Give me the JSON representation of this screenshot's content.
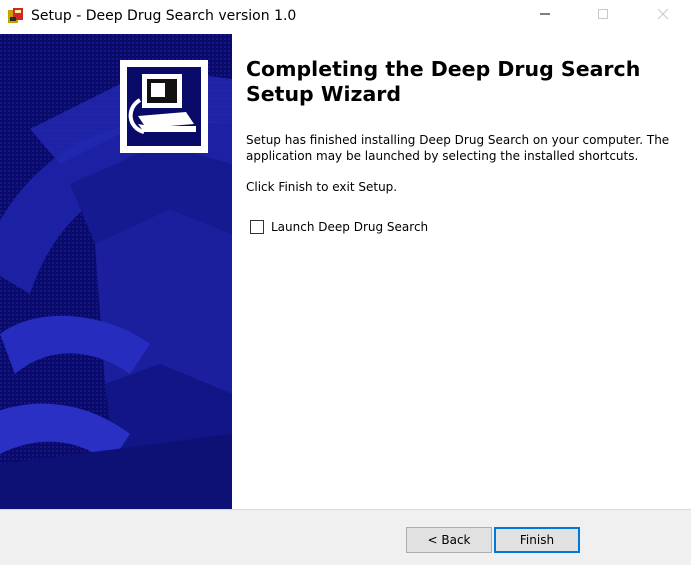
{
  "window": {
    "title": "Setup - Deep Drug Search version 1.0",
    "icon": "setup-icon",
    "controls": [
      "minimize-icon",
      "maximize-icon",
      "close-icon"
    ]
  },
  "content": {
    "heading": "Completing the Deep Drug Search Setup Wizard",
    "body": "Setup has finished installing Deep Drug Search on your computer. The application may be launched by selecting the installed shortcuts.",
    "exit_hint": "Click Finish to exit Setup.",
    "launch_checkbox": {
      "label": "Launch Deep Drug Search",
      "checked": false
    }
  },
  "footer": {
    "back_label": "< Back",
    "finish_label": "Finish"
  },
  "colors": {
    "sidebar": "#0a0a68",
    "accent": "#0078d7"
  }
}
